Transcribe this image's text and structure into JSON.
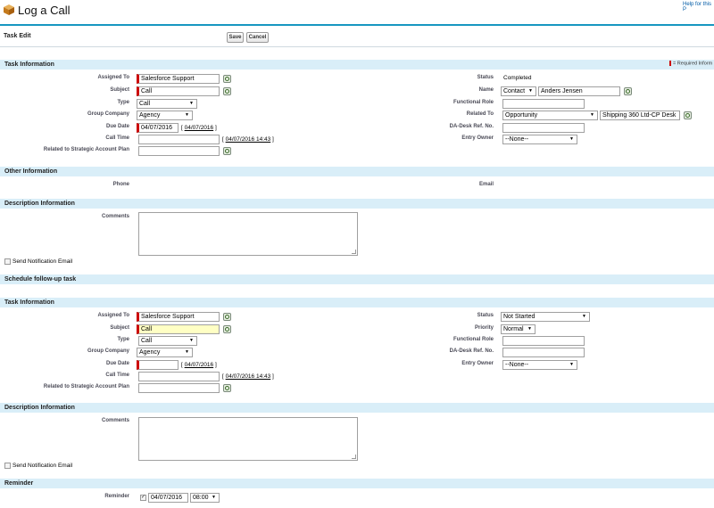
{
  "page": {
    "title": "Log a Call",
    "help": "Help for this P"
  },
  "toolbar": {
    "heading": "Task Edit",
    "save": "Save",
    "cancel": "Cancel"
  },
  "legend": "= Required Inform",
  "s1": {
    "title": "Task Information",
    "assigned_to_label": "Assigned To",
    "assigned_to": "Salesforce Support",
    "subject_label": "Subject",
    "subject": "Call",
    "type_label": "Type",
    "type": "Call",
    "group_company_label": "Group Company",
    "group_company": "Agency",
    "due_date_label": "Due Date",
    "due_date": "04/07/2016",
    "due_date_link": "04/07/2016",
    "call_time_label": "Call Time",
    "call_time_link": "04/07/2016 14:43",
    "strategic_label": "Related to Strategic Account Plan",
    "status_label": "Status",
    "status": "Completed",
    "name_label": "Name",
    "name_type": "Contact",
    "name": "Anders Jensen",
    "functional_role_label": "Functional Role",
    "related_to_label": "Related To",
    "related_type": "Opportunity",
    "related": "Shipping 360 Ltd-CP Desk",
    "ref_label": "DA-Desk Ref. No.",
    "entry_owner_label": "Entry Owner",
    "entry_owner": "--None--"
  },
  "other": {
    "title": "Other Information",
    "phone_label": "Phone",
    "email_label": "Email"
  },
  "desc1": {
    "title": "Description Information",
    "comments_label": "Comments",
    "notify": "Send Notification Email"
  },
  "followup": {
    "title": "Schedule follow-up task"
  },
  "s2": {
    "title": "Task Information",
    "assigned_to_label": "Assigned To",
    "assigned_to": "Salesforce Support",
    "subject_label": "Subject",
    "subject": "Call",
    "type_label": "Type",
    "type": "Call",
    "group_company_label": "Group Company",
    "group_company": "Agency",
    "due_date_label": "Due Date",
    "due_date_link": "04/07/2016",
    "call_time_label": "Call Time",
    "call_time_link": "04/07/2016 14:43",
    "strategic_label": "Related to Strategic Account Plan",
    "status_label": "Status",
    "status": "Not Started",
    "priority_label": "Priority",
    "priority": "Normal",
    "functional_role_label": "Functional Role",
    "ref_label": "DA-Desk Ref. No.",
    "entry_owner_label": "Entry Owner",
    "entry_owner": "--None--"
  },
  "desc2": {
    "title": "Description Information",
    "comments_label": "Comments",
    "notify": "Send Notification Email"
  },
  "reminder": {
    "title": "Reminder",
    "label": "Reminder",
    "date": "04/07/2016",
    "time": "08:00"
  },
  "colors": {
    "section_bg": "#d9eef8",
    "required": "#cc0000",
    "header_rule": "#1797c0",
    "highlight": "#ffffc4"
  }
}
